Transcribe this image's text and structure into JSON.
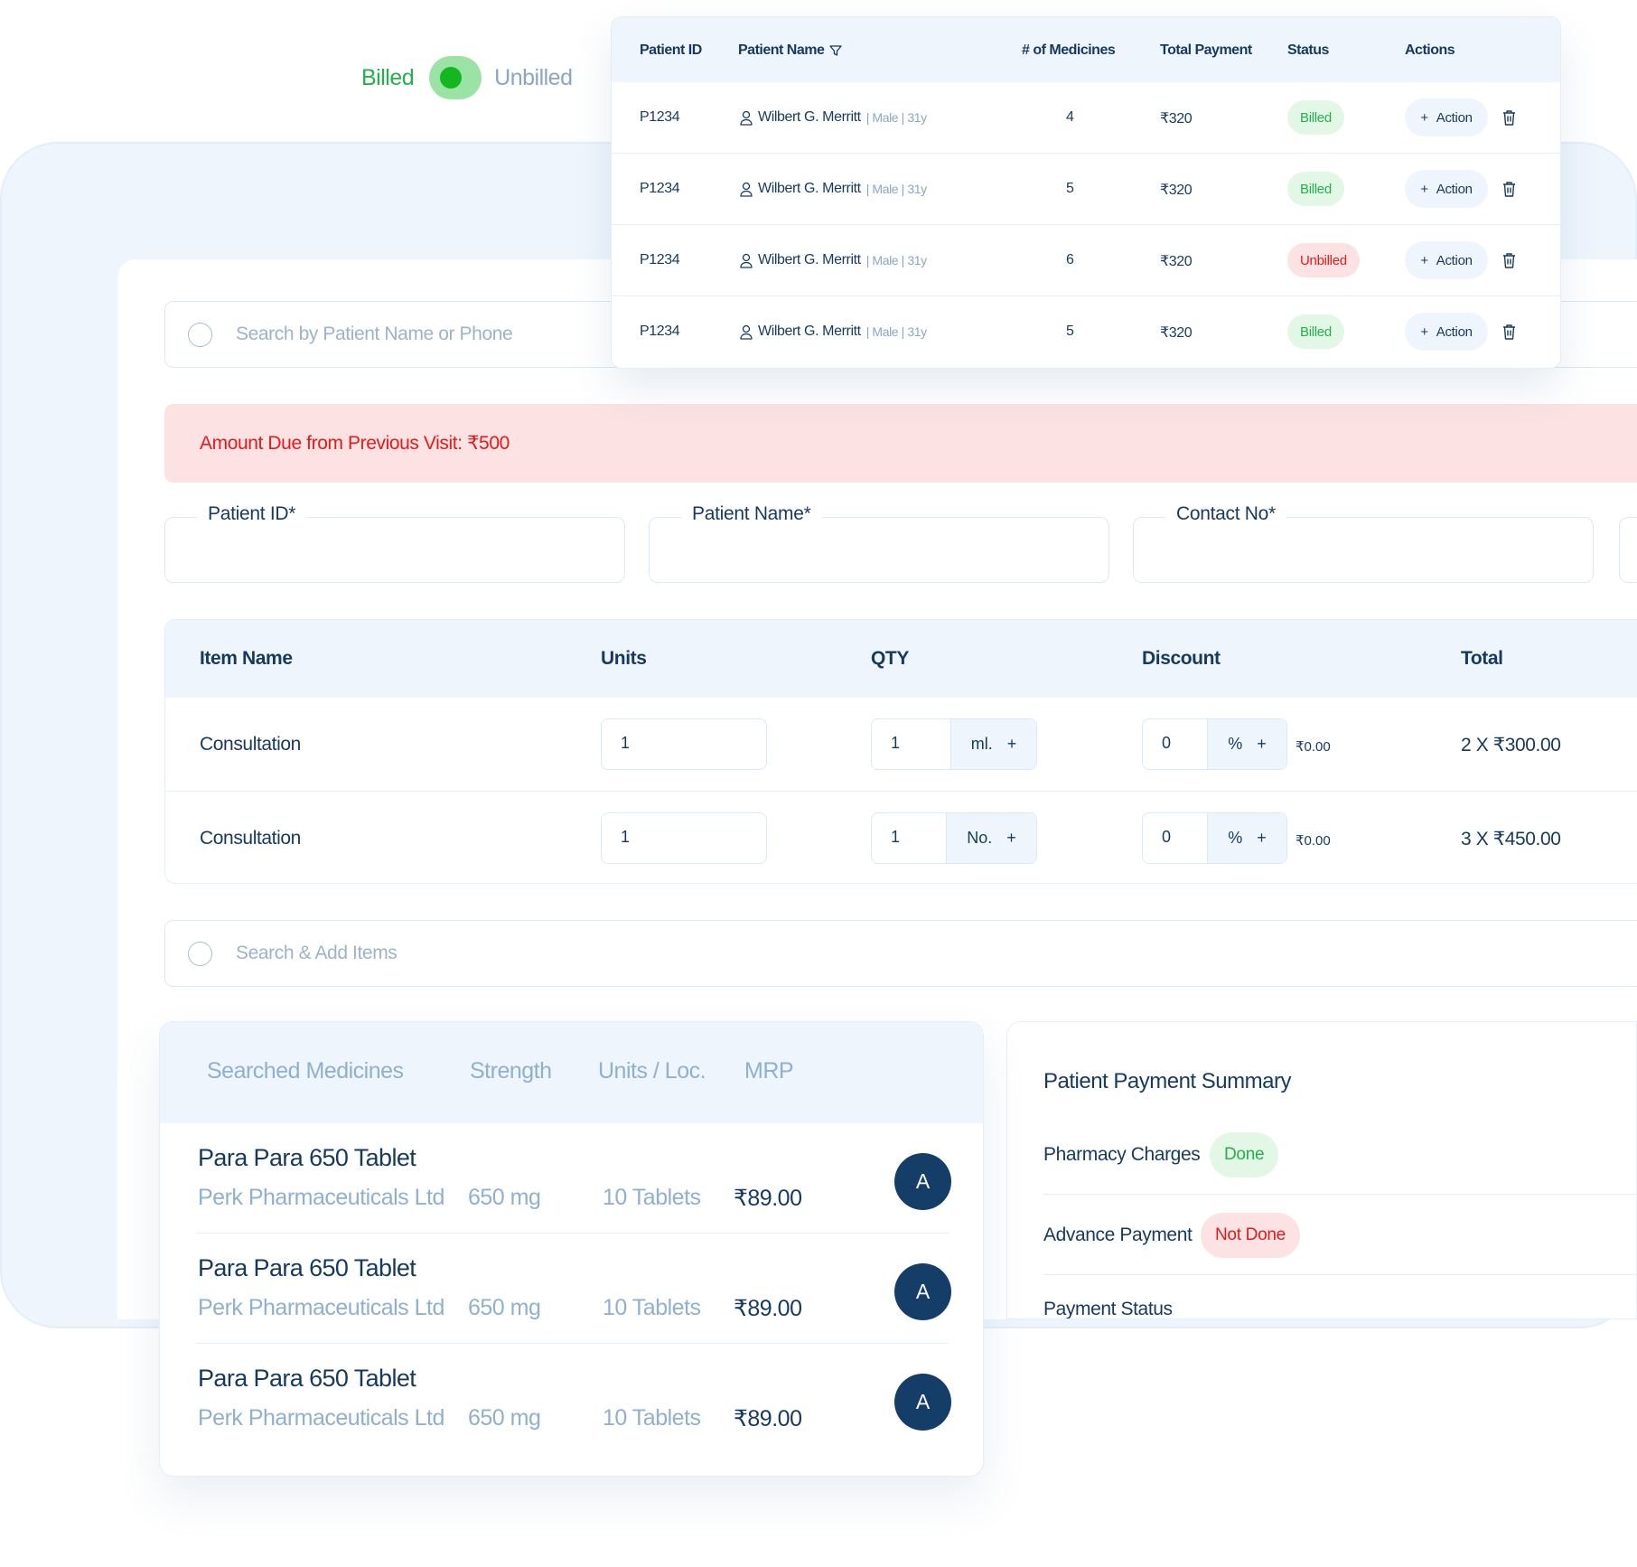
{
  "toggle": {
    "left_label": "Billed",
    "right_label": "Unbilled",
    "selected": "Billed"
  },
  "patients_table": {
    "headers": [
      "Patient ID",
      "Patient Name",
      "# of Medicines",
      "Total Payment",
      "Status",
      "Actions"
    ],
    "rows": [
      {
        "id": "P1234",
        "name": "Wilbert G. Merritt",
        "meta": "| Male | 31y",
        "medicines": "4",
        "payment": "₹320",
        "status": "Billed",
        "action": "Action"
      },
      {
        "id": "P1234",
        "name": "Wilbert G. Merritt",
        "meta": "| Male | 31y",
        "medicines": "5",
        "payment": "₹320",
        "status": "Billed",
        "action": "Action"
      },
      {
        "id": "P1234",
        "name": "Wilbert G. Merritt",
        "meta": "| Male | 31y",
        "medicines": "6",
        "payment": "₹320",
        "status": "Unbilled",
        "action": "Action"
      },
      {
        "id": "P1234",
        "name": "Wilbert G. Merritt",
        "meta": "| Male | 31y",
        "medicines": "5",
        "payment": "₹320",
        "status": "Billed",
        "action": "Action"
      }
    ]
  },
  "patient_search": {
    "placeholder": "Search by Patient Name or Phone"
  },
  "due_banner": {
    "text": "Amount Due from Previous Visit: ₹500"
  },
  "form_fields": {
    "patient_id": "Patient ID*",
    "patient_name": "Patient Name*",
    "contact_no": "Contact No*"
  },
  "items_table": {
    "headers": {
      "item": "Item Name",
      "units": "Units",
      "qty": "QTY",
      "discount": "Discount",
      "total": "Total"
    },
    "rows": [
      {
        "item": "Consultation",
        "units": "1",
        "qty": "1",
        "qty_unit": "ml.",
        "discount": "0",
        "discount_unit": "%",
        "discount_amount": "₹0.00",
        "total": "2 X ₹300.00"
      },
      {
        "item": "Consultation",
        "units": "1",
        "qty": "1",
        "qty_unit": "No.",
        "discount": "0",
        "discount_unit": "%",
        "discount_amount": "₹0.00",
        "total": "3 X ₹450.00"
      }
    ]
  },
  "item_search": {
    "placeholder": "Search & Add Items"
  },
  "searched_medicines": {
    "headers": {
      "name": "Searched Medicines",
      "strength": "Strength",
      "units": "Units / Loc.",
      "mrp": "MRP"
    },
    "rows": [
      {
        "name": "Para Para 650 Tablet",
        "maker": "Perk Pharmaceuticals Ltd",
        "strength": "650 mg",
        "units": "10 Tablets",
        "mrp": "₹89.00",
        "avatar": "A"
      },
      {
        "name": "Para Para 650 Tablet",
        "maker": "Perk Pharmaceuticals Ltd",
        "strength": "650 mg",
        "units": "10 Tablets",
        "mrp": "₹89.00",
        "avatar": "A"
      },
      {
        "name": "Para Para 650 Tablet",
        "maker": "Perk Pharmaceuticals Ltd",
        "strength": "650 mg",
        "units": "10 Tablets",
        "mrp": "₹89.00",
        "avatar": "A"
      }
    ]
  },
  "payment_summary": {
    "title": "Patient Payment Summary",
    "rows": [
      {
        "label": "Pharmacy Charges",
        "badge": "Done"
      },
      {
        "label": "Advance Payment",
        "badge": "Not Done"
      },
      {
        "label": "Payment Status"
      }
    ]
  },
  "colors": {
    "accent_navy": "#163a5f",
    "billed_green": "#22b14c",
    "unbilled_red": "#e31b1b",
    "panel_bg": "#eef5fd"
  }
}
